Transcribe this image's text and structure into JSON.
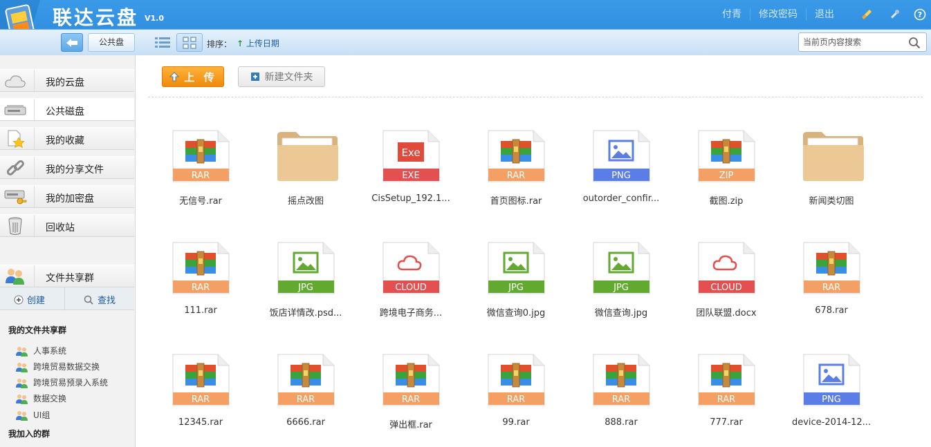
{
  "app": {
    "title": "联达云盘",
    "version": "V1.0"
  },
  "header": {
    "user": "付青",
    "change_password": "修改密码",
    "logout": "退出",
    "icons": [
      "broom-icon",
      "tools-icon",
      "help-icon"
    ]
  },
  "toolbar": {
    "back_icon": "back-arrow-icon",
    "breadcrumb": "公共盘",
    "sort_label": "排序：",
    "sort_value": "上传日期",
    "search_placeholder": "当前页内容搜索"
  },
  "sidebar": {
    "items": [
      {
        "label": "我的云盘",
        "icon": "cloud-icon"
      },
      {
        "label": "公共磁盘",
        "icon": "disk-icon",
        "active": true
      },
      {
        "label": "我的收藏",
        "icon": "favorite-icon"
      },
      {
        "label": "我的分享文件",
        "icon": "link-icon"
      },
      {
        "label": "我的加密盘",
        "icon": "encrypted-disk-icon"
      },
      {
        "label": "回收站",
        "icon": "trash-icon"
      }
    ],
    "share_group": {
      "label": "文件共享群",
      "icon": "users-icon"
    },
    "create_label": "创建",
    "find_label": "查找",
    "my_groups_title": "我的文件共享群",
    "my_groups": [
      "人事系统",
      "跨境贸易数据交换",
      "跨境贸易预录入系统",
      "数据交换",
      "UI组"
    ],
    "joined_groups_title": "我加入的群"
  },
  "main": {
    "upload_label": "上 传",
    "new_folder_label": "新建文件夹",
    "files": [
      {
        "name": "无信号.rar",
        "type": "RAR"
      },
      {
        "name": "摇点改图",
        "type": "FOLDER"
      },
      {
        "name": "CisSetup_192.1...",
        "type": "EXE"
      },
      {
        "name": "首页图标.rar",
        "type": "RAR"
      },
      {
        "name": "outorder_confir...",
        "type": "PNG"
      },
      {
        "name": "截图.zip",
        "type": "ZIP"
      },
      {
        "name": "新闻类切图",
        "type": "FOLDER"
      },
      {
        "name": "111.rar",
        "type": "RAR"
      },
      {
        "name": "饭店详情改.psd...",
        "type": "JPG"
      },
      {
        "name": "跨境电子商务...",
        "type": "CLOUD"
      },
      {
        "name": "微信查询0.jpg",
        "type": "JPG"
      },
      {
        "name": "微信查询.jpg",
        "type": "JPG"
      },
      {
        "name": "团队联盟.docx",
        "type": "CLOUD"
      },
      {
        "name": "678.rar",
        "type": "RAR"
      },
      {
        "name": "12345.rar",
        "type": "RAR"
      },
      {
        "name": "6666.rar",
        "type": "RAR"
      },
      {
        "name": "弹出框.rar",
        "type": "RAR"
      },
      {
        "name": "99.rar",
        "type": "RAR"
      },
      {
        "name": "888.rar",
        "type": "RAR"
      },
      {
        "name": "777.rar",
        "type": "RAR"
      },
      {
        "name": "device-2014-12...",
        "type": "PNG"
      }
    ]
  },
  "colors": {
    "header_blue": "#2a86d8",
    "rar": "#f4a064",
    "exe": "#e45050",
    "png": "#5b7de6",
    "jpg": "#62a930",
    "cloud": "#e45050",
    "upload": "#f39a1a"
  }
}
